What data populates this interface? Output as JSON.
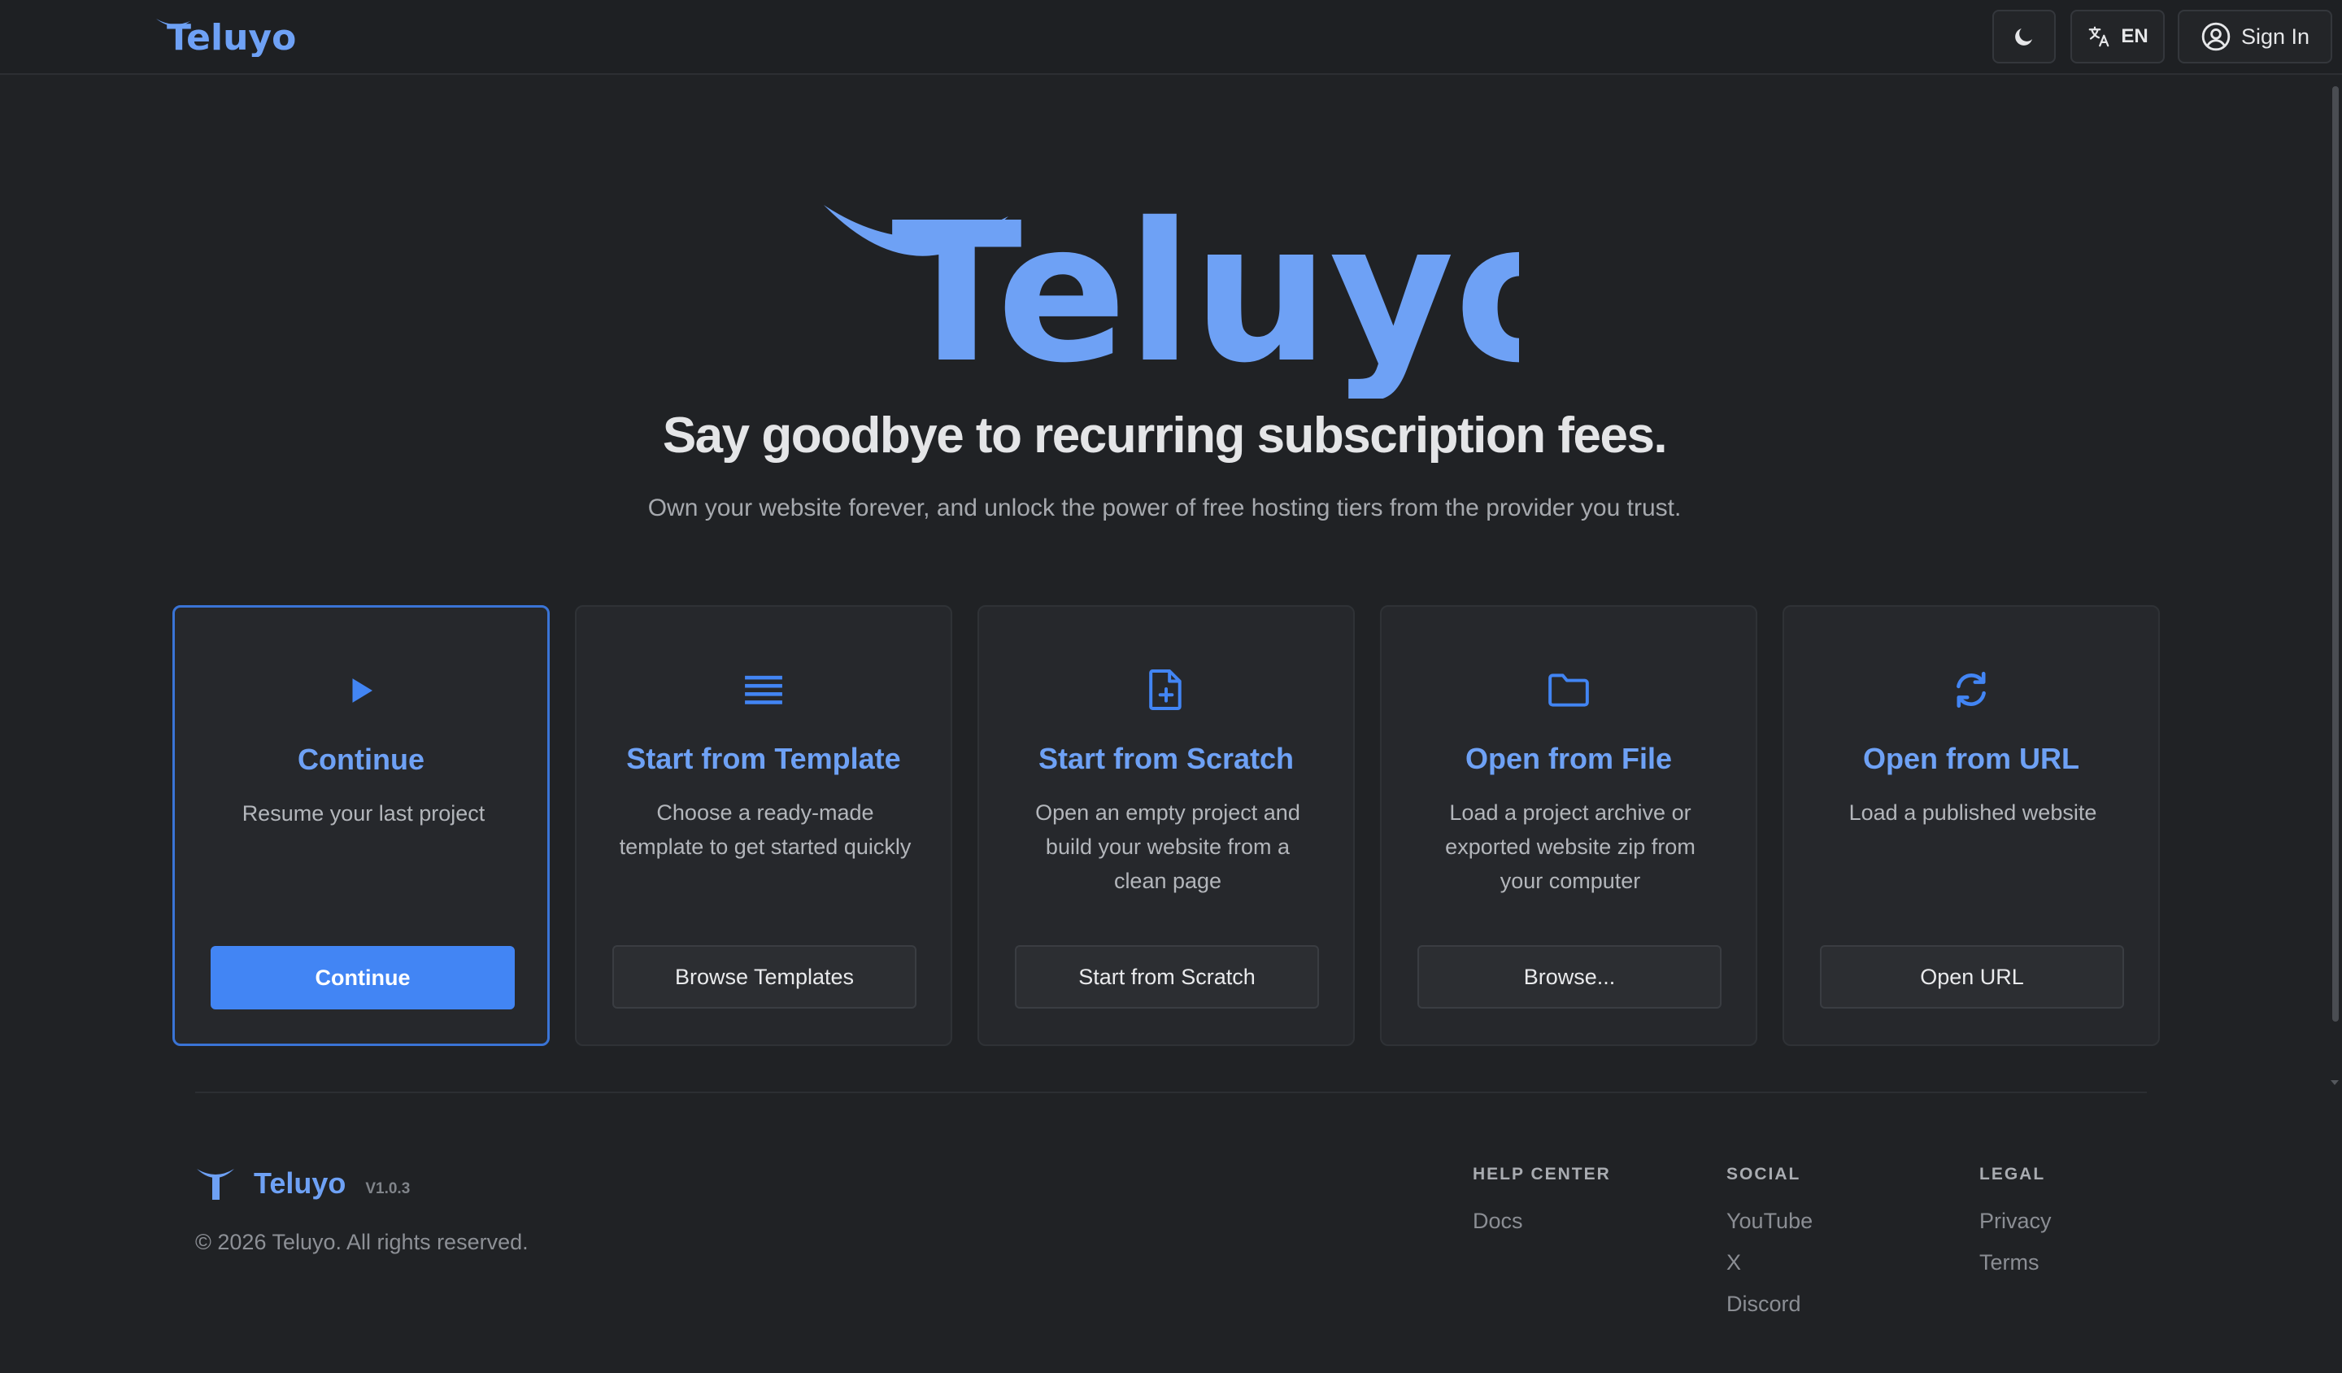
{
  "header": {
    "brand": "Teluyo",
    "language_label": "EN",
    "signin_label": "Sign In"
  },
  "hero": {
    "brand": "Teluyo",
    "headline": "Say goodbye to recurring subscription fees.",
    "subline": "Own your website forever, and unlock the power of free hosting tiers from the provider you trust."
  },
  "cards": [
    {
      "title": "Continue",
      "description": "Resume your last project",
      "button": "Continue",
      "icon": "play-icon"
    },
    {
      "title": "Start from Template",
      "description": "Choose a ready-made template to get started quickly",
      "button": "Browse Templates",
      "icon": "list-icon"
    },
    {
      "title": "Start from Scratch",
      "description": "Open an empty project and build your website from a clean page",
      "button": "Start from Scratch",
      "icon": "file-plus-icon"
    },
    {
      "title": "Open from File",
      "description": "Load a project archive or exported website zip from your computer",
      "button": "Browse...",
      "icon": "folder-icon"
    },
    {
      "title": "Open from URL",
      "description": "Load a published website",
      "button": "Open URL",
      "icon": "refresh-icon"
    }
  ],
  "footer": {
    "brand": "Teluyo",
    "version": "V1.0.3",
    "copyright": "© 2026 Teluyo. All rights reserved.",
    "columns": [
      {
        "heading": "HELP CENTER",
        "links": [
          "Docs"
        ]
      },
      {
        "heading": "SOCIAL",
        "links": [
          "YouTube",
          "X",
          "Discord"
        ]
      },
      {
        "heading": "LEGAL",
        "links": [
          "Privacy",
          "Terms"
        ]
      }
    ]
  },
  "colors": {
    "accent": "#4285f4",
    "brand_blue": "#6ea1f5",
    "background": "#202225",
    "card_background": "#26282c"
  }
}
